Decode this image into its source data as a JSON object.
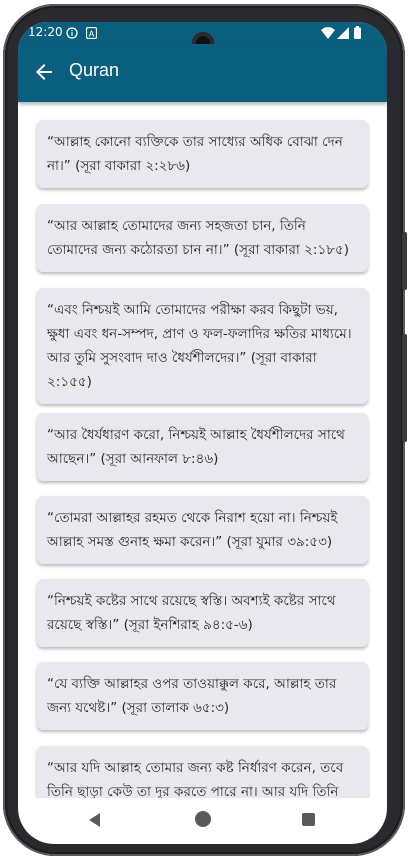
{
  "status_bar": {
    "time": "12:20",
    "icons_left": [
      "info-circle-icon",
      "notification-a-icon"
    ],
    "icons_right": [
      "wifi-icon",
      "signal-icon",
      "battery-icon"
    ]
  },
  "app_bar": {
    "title": "Quran",
    "back_icon": "arrow-left-icon",
    "color": "#0b5f7e"
  },
  "verses": [
    "“আল্লাহ কোনো ব্যক্তিকে তার সাধ্যের অধিক বোঝা দেন না।” (সূরা বাকারা ২:২৮৬)",
    "“আর আল্লাহ তোমাদের জন্য সহজতা চান, তিনি তোমাদের জন্য কঠোরতা চান না।” (সূরা বাকারা ২:১৮৫)",
    "“এবং নিশ্চয়ই আমি তোমাদের পরীক্ষা করব কিছুটা ভয়, ক্ষুধা এবং ধন-সম্পদ, প্রাণ ও ফল-ফলাদির ক্ষতির মাধ্যমে। আর তুমি সুসংবাদ দাও ধৈর্যশীলদের।” (সূরা বাকারা ২:১৫৫)",
    "“আর ধৈর্যধারণ করো, নিশ্চয়ই আল্লাহ ধৈর্যশীলদের সাথে আছেন।” (সূরা আনফাল ৮:৪৬)",
    "“তোমরা আল্লাহর রহমত থেকে নিরাশ হয়ো না। নিশ্চয়ই আল্লাহ সমস্ত গুনাহ ক্ষমা করেন।” (সূরা যুমার ৩৯:৫৩)",
    "“নিশ্চয়ই কষ্টের সাথে রয়েছে স্বস্তি। অবশ্যই কষ্টের সাথে রয়েছে স্বস্তি।” (সূরা ইনশিরাহ ৯৪:৫-৬)",
    "“যে ব্যক্তি আল্লাহর ওপর তাওয়াক্কুল করে, আল্লাহ তার জন্য যথেষ্ট।” (সূরা তালাক ৬৫:৩)",
    "“আর যদি আল্লাহ তোমার জন্য কষ্ট নির্ধারণ করেন, তবে তিনি ছাড়া কেউ তা দূর করতে পারে না। আর যদি তিনি"
  ],
  "nav_bar": {
    "back": "triangle-back-icon",
    "home": "circle-home-icon",
    "recents": "square-recents-icon"
  }
}
